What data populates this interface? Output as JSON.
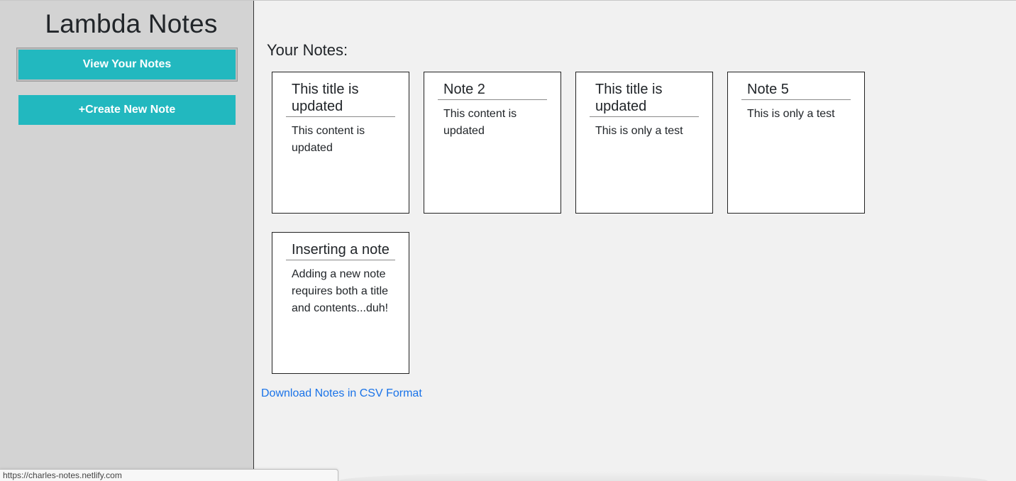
{
  "sidebar": {
    "app_title": "Lambda Notes",
    "view_button": "View Your Notes",
    "create_button": "+Create New Note",
    "accent_color": "#22b8bf"
  },
  "main": {
    "section_title": "Your Notes:",
    "notes": [
      {
        "title": "This title is updated",
        "content": "This content is updated"
      },
      {
        "title": "Note 2",
        "content": "This content is updated"
      },
      {
        "title": "This title is updated",
        "content": "This is only a test"
      },
      {
        "title": "Note 5",
        "content": "This is only a test"
      },
      {
        "title": "Inserting a note",
        "content": "Adding a new note requires both a title and contents...duh!"
      }
    ],
    "download_link": "Download Notes in CSV Format",
    "link_color": "#1a73e8"
  },
  "status_bar": {
    "url": "https://charles-notes.netlify.com"
  }
}
